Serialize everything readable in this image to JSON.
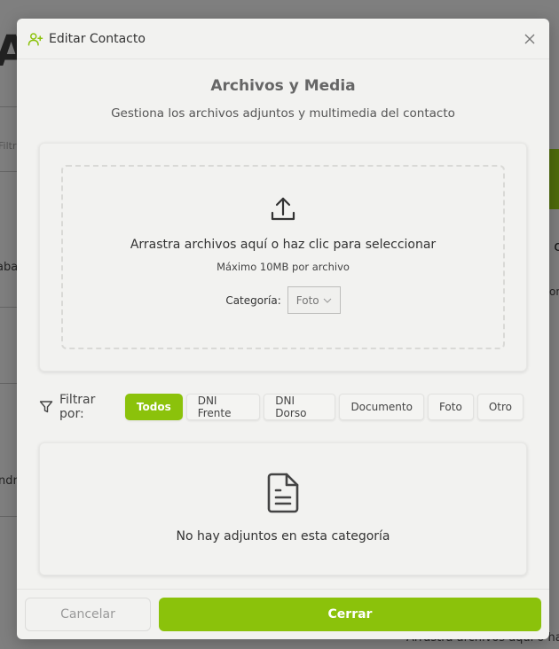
{
  "background": {
    "title_fragment": "A",
    "filter_fragment": "Filtr",
    "text_fragment_1": "aba",
    "text_fragment_2": "ndr",
    "right_fragment_1": "o",
    "right_fragment_2": "on",
    "bottom_text": "Arrastra archivos aquí o ha"
  },
  "modal": {
    "title": "Editar Contacto",
    "header_icon": "user-plus-icon",
    "close_icon": "close-icon"
  },
  "section": {
    "title": "Archivos y Media",
    "subtitle": "Gestiona los archivos adjuntos y multimedia del contacto"
  },
  "upload": {
    "icon": "upload-icon",
    "text": "Arrastra archivos aquí o haz clic para seleccionar",
    "limit": "Máximo 10MB por archivo",
    "category_label": "Categoría:",
    "category_value": "Foto"
  },
  "filter": {
    "label": "Filtrar por:",
    "chips": [
      "Todos",
      "DNI Frente",
      "DNI Dorso",
      "Documento",
      "Foto",
      "Otro"
    ],
    "active": "Todos"
  },
  "empty": {
    "icon": "document-icon",
    "text": "No hay adjuntos en esta categoría"
  },
  "footer": {
    "cancel_label": "Cancelar",
    "close_label": "Cerrar"
  },
  "colors": {
    "accent": "#8bc20b",
    "backdrop": "#7f7f7f"
  }
}
